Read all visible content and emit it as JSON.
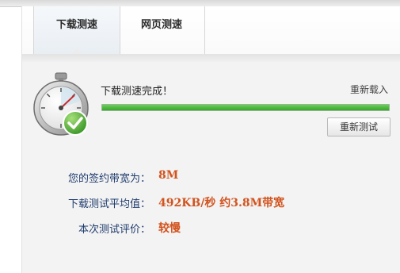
{
  "tabs": [
    {
      "label": "下载测速"
    },
    {
      "label": "网页测速"
    }
  ],
  "status": {
    "title": "下载测速完成！",
    "reload_label": "重新载入",
    "progress_fraction": 1.0,
    "retest_label": "重新测试"
  },
  "info": {
    "bandwidth_label": "您的签约带宽为：",
    "bandwidth_value": "8M",
    "average_label": "下载测试平均值：",
    "average_value": "492KB/秒 约3.8M带宽",
    "rating_label": "本次测试评价：",
    "rating_value": "较慢"
  },
  "colors": {
    "accent_value": "#d2531e",
    "label_blue": "#1f3c6e",
    "progress_green": "#3aa52c"
  },
  "icons": {
    "timer": "stopwatch-icon",
    "check": "check-icon"
  }
}
